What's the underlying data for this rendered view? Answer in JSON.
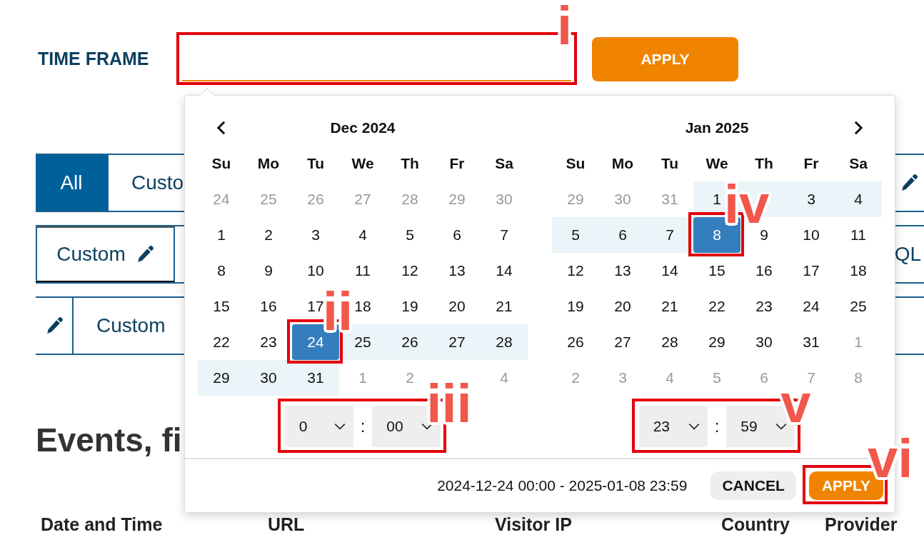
{
  "time_frame": {
    "label": "TIME FRAME",
    "annotation": "i"
  },
  "apply_button": "APPLY",
  "tabs": [
    {
      "label": "All",
      "selected": true
    },
    {
      "label": "Custo",
      "selected": false
    }
  ],
  "filter_row_1": {
    "items": [
      "Custom",
      "QL"
    ]
  },
  "filter_row_2": {
    "items": [
      "Custom"
    ]
  },
  "heading": "Events, fi",
  "table": {
    "columns": [
      "Date and Time",
      "URL",
      "Visitor IP",
      "Country",
      "Provider"
    ]
  },
  "date_picker": {
    "calendars": [
      {
        "month": "Dec 2024",
        "kind": "start",
        "weekdays": [
          "Su",
          "Mo",
          "Tu",
          "We",
          "Th",
          "Fr",
          "Sa"
        ],
        "weeks": [
          [
            {
              "d": "24",
              "off": true,
              "in_range": false,
              "selected": false
            },
            {
              "d": "25",
              "off": true,
              "in_range": false,
              "selected": false
            },
            {
              "d": "26",
              "off": true,
              "in_range": false,
              "selected": false
            },
            {
              "d": "27",
              "off": true,
              "in_range": false,
              "selected": false
            },
            {
              "d": "28",
              "off": true,
              "in_range": false,
              "selected": false
            },
            {
              "d": "29",
              "off": true,
              "in_range": false,
              "selected": false
            },
            {
              "d": "30",
              "off": true,
              "in_range": false,
              "selected": false
            }
          ],
          [
            {
              "d": "1",
              "off": false,
              "in_range": false,
              "selected": false
            },
            {
              "d": "2",
              "off": false,
              "in_range": false,
              "selected": false
            },
            {
              "d": "3",
              "off": false,
              "in_range": false,
              "selected": false
            },
            {
              "d": "4",
              "off": false,
              "in_range": false,
              "selected": false
            },
            {
              "d": "5",
              "off": false,
              "in_range": false,
              "selected": false
            },
            {
              "d": "6",
              "off": false,
              "in_range": false,
              "selected": false
            },
            {
              "d": "7",
              "off": false,
              "in_range": false,
              "selected": false
            }
          ],
          [
            {
              "d": "8",
              "off": false,
              "in_range": false,
              "selected": false
            },
            {
              "d": "9",
              "off": false,
              "in_range": false,
              "selected": false
            },
            {
              "d": "10",
              "off": false,
              "in_range": false,
              "selected": false
            },
            {
              "d": "11",
              "off": false,
              "in_range": false,
              "selected": false
            },
            {
              "d": "12",
              "off": false,
              "in_range": false,
              "selected": false
            },
            {
              "d": "13",
              "off": false,
              "in_range": false,
              "selected": false
            },
            {
              "d": "14",
              "off": false,
              "in_range": false,
              "selected": false
            }
          ],
          [
            {
              "d": "15",
              "off": false,
              "in_range": false,
              "selected": false
            },
            {
              "d": "16",
              "off": false,
              "in_range": false,
              "selected": false
            },
            {
              "d": "17",
              "off": false,
              "in_range": false,
              "selected": false
            },
            {
              "d": "18",
              "off": false,
              "in_range": false,
              "selected": false
            },
            {
              "d": "19",
              "off": false,
              "in_range": false,
              "selected": false
            },
            {
              "d": "20",
              "off": false,
              "in_range": false,
              "selected": false
            },
            {
              "d": "21",
              "off": false,
              "in_range": false,
              "selected": false
            }
          ],
          [
            {
              "d": "22",
              "off": false,
              "in_range": false,
              "selected": false
            },
            {
              "d": "23",
              "off": false,
              "in_range": false,
              "selected": false
            },
            {
              "d": "24",
              "off": false,
              "in_range": false,
              "selected": true,
              "annotation": "ii"
            },
            {
              "d": "25",
              "off": false,
              "in_range": true,
              "selected": false
            },
            {
              "d": "26",
              "off": false,
              "in_range": true,
              "selected": false
            },
            {
              "d": "27",
              "off": false,
              "in_range": true,
              "selected": false
            },
            {
              "d": "28",
              "off": false,
              "in_range": true,
              "selected": false
            }
          ],
          [
            {
              "d": "29",
              "off": false,
              "in_range": true,
              "selected": false
            },
            {
              "d": "30",
              "off": false,
              "in_range": true,
              "selected": false
            },
            {
              "d": "31",
              "off": false,
              "in_range": true,
              "selected": false
            },
            {
              "d": "1",
              "off": true,
              "in_range": false,
              "selected": false
            },
            {
              "d": "2",
              "off": true,
              "in_range": false,
              "selected": false
            },
            {
              "in_range": false
            },
            {
              "d": "4",
              "off": true,
              "in_range": false,
              "selected": false
            }
          ]
        ],
        "time": {
          "hour": "0",
          "separator": ":",
          "minute": "00",
          "annotation": "iii"
        }
      },
      {
        "month": "Jan 2025",
        "kind": "end",
        "weekdays": [
          "Su",
          "Mo",
          "Tu",
          "We",
          "Th",
          "Fr",
          "Sa"
        ],
        "weeks": [
          [
            {
              "d": "29",
              "off": true,
              "in_range": false,
              "selected": false
            },
            {
              "d": "30",
              "off": true,
              "in_range": false,
              "selected": false
            },
            {
              "d": "31",
              "off": true,
              "in_range": false,
              "selected": false
            },
            {
              "d": "1",
              "off": false,
              "in_range": true,
              "selected": false
            },
            {
              "in_range": true
            },
            {
              "d": "3",
              "off": false,
              "in_range": true,
              "selected": false
            },
            {
              "d": "4",
              "off": false,
              "in_range": true,
              "selected": false
            }
          ],
          [
            {
              "d": "5",
              "off": false,
              "in_range": true,
              "selected": false
            },
            {
              "d": "6",
              "off": false,
              "in_range": true,
              "selected": false
            },
            {
              "d": "7",
              "off": false,
              "in_range": true,
              "selected": false
            },
            {
              "d": "8",
              "off": false,
              "in_range": false,
              "selected": true,
              "annotation": "iv"
            },
            {
              "d": "9",
              "off": false,
              "in_range": false,
              "selected": false
            },
            {
              "d": "10",
              "off": false,
              "in_range": false,
              "selected": false
            },
            {
              "d": "11",
              "off": false,
              "in_range": false,
              "selected": false
            }
          ],
          [
            {
              "d": "12",
              "off": false,
              "in_range": false,
              "selected": false
            },
            {
              "d": "13",
              "off": false,
              "in_range": false,
              "selected": false
            },
            {
              "d": "14",
              "off": false,
              "in_range": false,
              "selected": false
            },
            {
              "d": "15",
              "off": false,
              "in_range": false,
              "selected": false
            },
            {
              "d": "16",
              "off": false,
              "in_range": false,
              "selected": false
            },
            {
              "d": "17",
              "off": false,
              "in_range": false,
              "selected": false
            },
            {
              "d": "18",
              "off": false,
              "in_range": false,
              "selected": false
            }
          ],
          [
            {
              "d": "19",
              "off": false,
              "in_range": false,
              "selected": false
            },
            {
              "d": "20",
              "off": false,
              "in_range": false,
              "selected": false
            },
            {
              "d": "21",
              "off": false,
              "in_range": false,
              "selected": false
            },
            {
              "d": "22",
              "off": false,
              "in_range": false,
              "selected": false
            },
            {
              "d": "23",
              "off": false,
              "in_range": false,
              "selected": false
            },
            {
              "d": "24",
              "off": false,
              "in_range": false,
              "selected": false
            },
            {
              "d": "25",
              "off": false,
              "in_range": false,
              "selected": false
            }
          ],
          [
            {
              "d": "26",
              "off": false,
              "in_range": false,
              "selected": false
            },
            {
              "d": "27",
              "off": false,
              "in_range": false,
              "selected": false
            },
            {
              "d": "28",
              "off": false,
              "in_range": false,
              "selected": false
            },
            {
              "d": "29",
              "off": false,
              "in_range": false,
              "selected": false
            },
            {
              "d": "30",
              "off": false,
              "in_range": false,
              "selected": false
            },
            {
              "d": "31",
              "off": false,
              "in_range": false,
              "selected": false
            },
            {
              "d": "1",
              "off": true,
              "in_range": false,
              "selected": false
            }
          ],
          [
            {
              "d": "2",
              "off": true,
              "in_range": false,
              "selected": false
            },
            {
              "d": "3",
              "off": true,
              "in_range": false,
              "selected": false
            },
            {
              "d": "4",
              "off": true,
              "in_range": false,
              "selected": false
            },
            {
              "d": "5",
              "off": true,
              "in_range": false,
              "selected": false
            },
            {
              "d": "6",
              "off": true,
              "in_range": false,
              "selected": false
            },
            {
              "d": "7",
              "off": true,
              "in_range": false,
              "selected": false
            },
            {
              "d": "8",
              "off": true,
              "in_range": false,
              "selected": false
            }
          ]
        ],
        "time": {
          "hour": "23",
          "separator": ":",
          "minute": "59",
          "annotation": "v"
        }
      }
    ],
    "range_text": "2024-12-24 00:00 - 2025-01-08 23:59",
    "cancel_button": "CANCEL",
    "apply_button": {
      "label": "APPLY",
      "annotation": "vi"
    }
  }
}
